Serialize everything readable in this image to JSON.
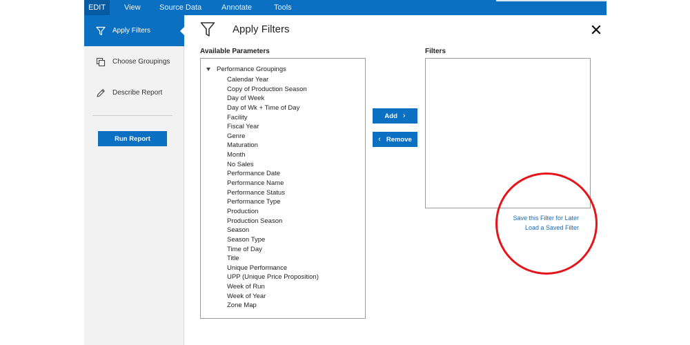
{
  "menubar": {
    "items": [
      "EDIT",
      "View",
      "Source Data",
      "Annotate",
      "Tools"
    ],
    "active": "EDIT"
  },
  "sidebar": {
    "items": [
      {
        "label": "Apply Filters",
        "icon": "funnel-icon",
        "active": true
      },
      {
        "label": "Choose Groupings",
        "icon": "groupings-icon",
        "active": false
      },
      {
        "label": "Describe Report",
        "icon": "pencil-icon",
        "active": false
      }
    ],
    "run_report_label": "Run Report"
  },
  "main": {
    "title": "Apply Filters",
    "available_label": "Available Parameters",
    "filters_label": "Filters",
    "tree_root": "Performance Groupings",
    "parameters": [
      "Calendar Year",
      "Copy of Production Season",
      "Day of Week",
      "Day of Wk + Time of Day",
      "Facility",
      "Fiscal Year",
      "Genre",
      "Maturation",
      "Month",
      "No Sales",
      "Performance Date",
      "Performance Name",
      "Performance Status",
      "Performance Type",
      "Production",
      "Production Season",
      "Season",
      "Season Type",
      "Time of Day",
      "Title",
      "Unique Performance",
      "UPP (Unique Price Proposition)",
      "Week of Run",
      "Week of Year",
      "Zone Map"
    ],
    "add_label": "Add",
    "remove_label": "Remove",
    "save_filter_link": "Save this Filter for Later",
    "load_filter_link": "Load a Saved Filter"
  },
  "colors": {
    "accent": "#0b6fc2",
    "highlight": "#e5141b",
    "link": "#1a6bb8"
  }
}
